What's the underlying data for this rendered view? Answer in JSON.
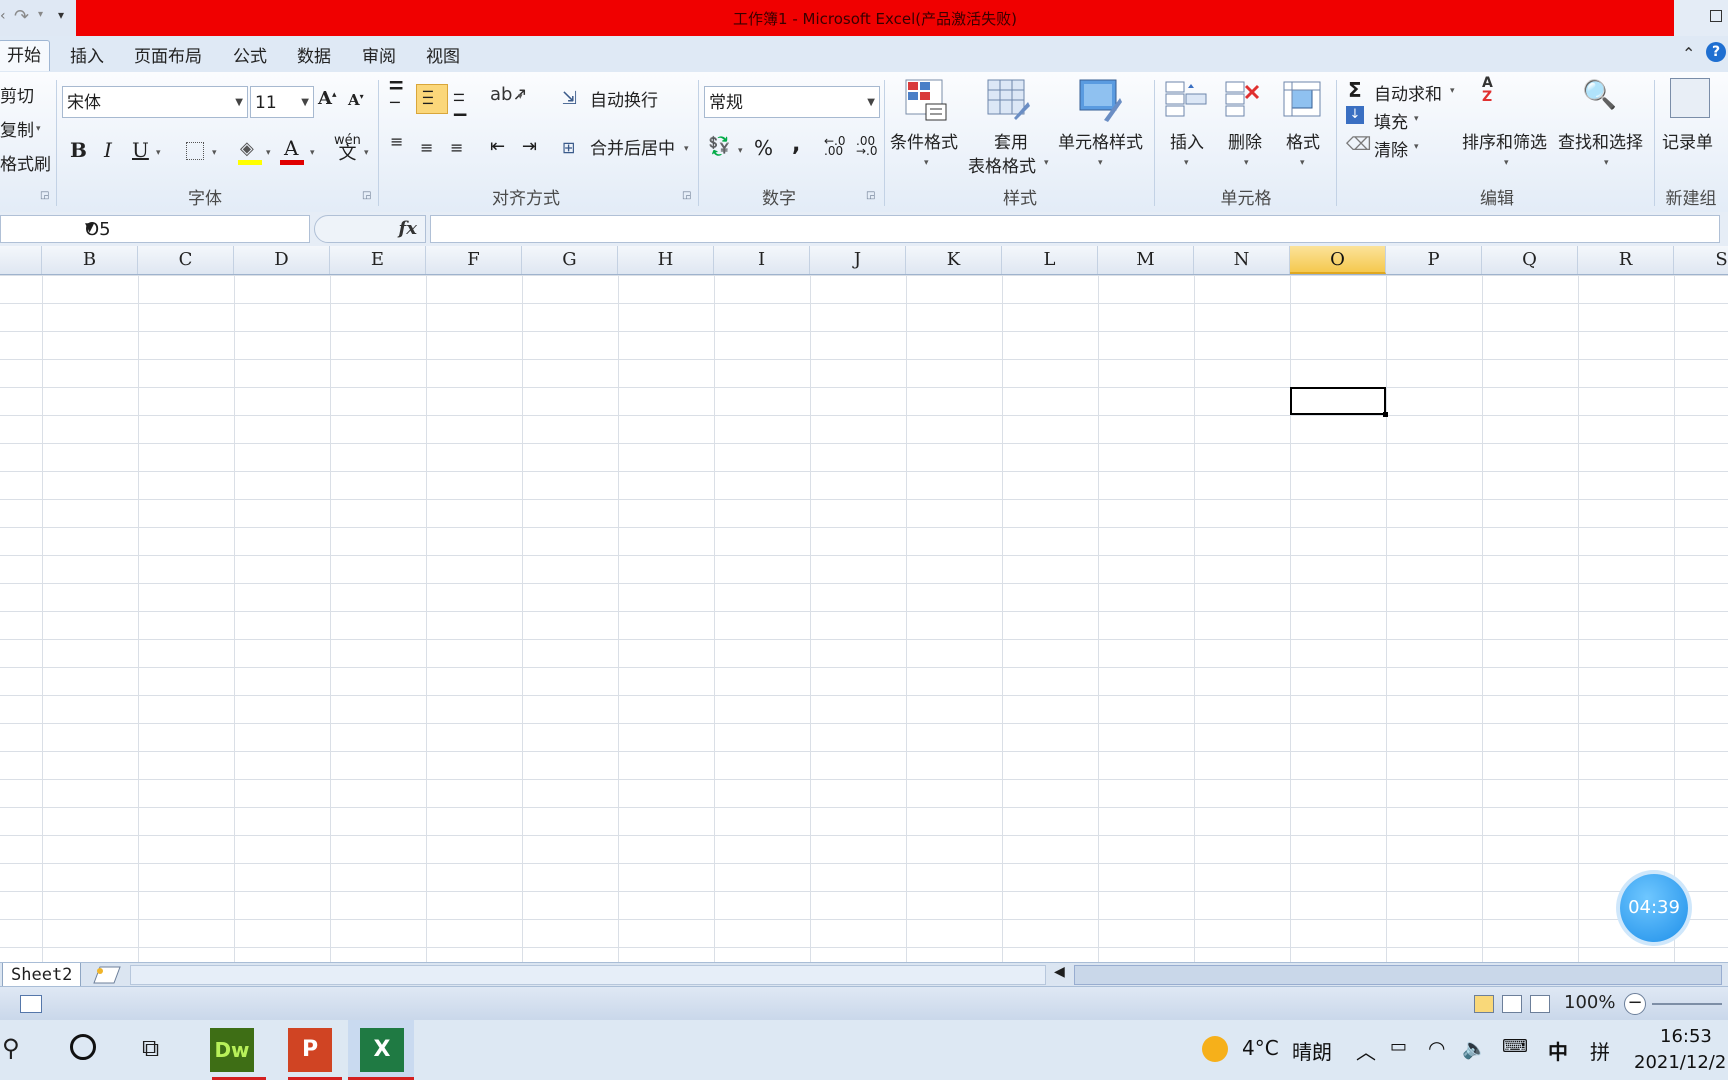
{
  "window": {
    "title": "工作簿1 - Microsoft Excel(产品激活失败)"
  },
  "tabs": [
    "开始",
    "插入",
    "页面布局",
    "公式",
    "数据",
    "审阅",
    "视图"
  ],
  "ribbon": {
    "clipboard": {
      "cut": "剪切",
      "copy": "复制",
      "format_painter": "格式刷"
    },
    "font": {
      "name": "宋体",
      "size": "11",
      "bold": "B",
      "italic": "I",
      "underline": "U",
      "group_label": "字体"
    },
    "alignment": {
      "wrap_text": "自动换行",
      "merge_center": "合并后居中",
      "group_label": "对齐方式"
    },
    "number": {
      "format": "常规",
      "percent": "%",
      "comma": ",",
      "group_label": "数字"
    },
    "styles": {
      "conditional": "条件格式",
      "table_1": "套用",
      "table_2": "表格格式",
      "cell_styles": "单元格样式",
      "group_label": "样式"
    },
    "cells": {
      "insert": "插入",
      "delete": "删除",
      "format": "格式",
      "group_label": "单元格"
    },
    "editing": {
      "autosum": "自动求和",
      "fill": "填充",
      "clear": "清除",
      "sort_filter": "排序和筛选",
      "find_select": "查找和选择",
      "group_label": "编辑"
    },
    "new_group": {
      "record": "记录单",
      "group_label": "新建组"
    }
  },
  "formula_bar": {
    "name_box": "O5",
    "fx": "fx",
    "value": ""
  },
  "columns": [
    "B",
    "C",
    "D",
    "E",
    "F",
    "G",
    "H",
    "I",
    "J",
    "K",
    "L",
    "M",
    "N",
    "O",
    "P",
    "Q",
    "R",
    "S"
  ],
  "selected_column": "O",
  "sheet_tabs": [
    "Sheet2"
  ],
  "status": {
    "zoom": "100%"
  },
  "timer": "04:39",
  "taskbar": {
    "weather_temp": "4°C",
    "weather_text": "晴朗",
    "ime_lang": "中",
    "ime_mode": "拼",
    "time": "16:53",
    "date": "2021/12/2"
  },
  "colors": {
    "title_bar": "#f00000",
    "selected_header": "#f5c94f",
    "font_color_bar": "#e00000",
    "fill_color_bar": "#ffff00"
  }
}
